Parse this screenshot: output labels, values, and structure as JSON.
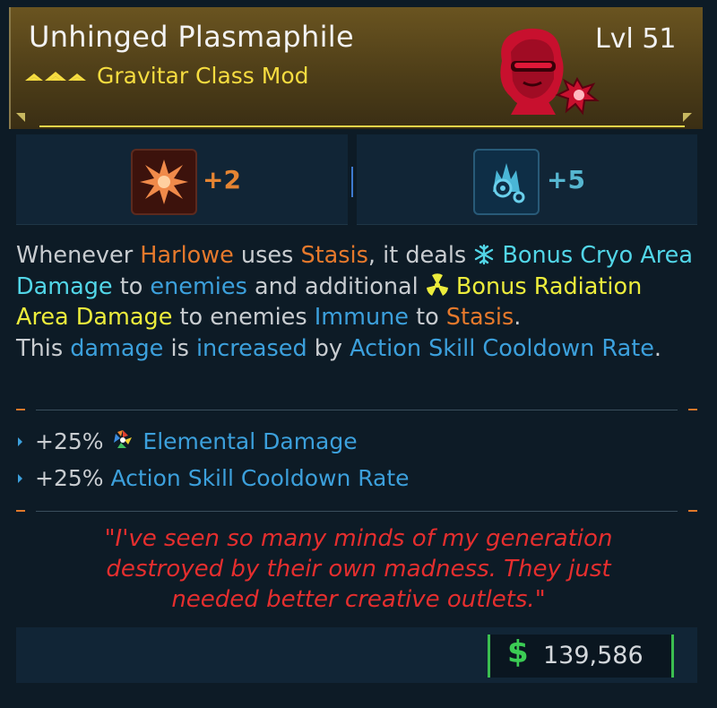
{
  "item": {
    "name": "Unhinged Plasmaphile",
    "type": "Gravitar Class Mod",
    "level": "Lvl 51"
  },
  "skills": {
    "left_bonus": "+2",
    "right_bonus": "+5"
  },
  "description": {
    "p1": "Whenever ",
    "harlowe": "Harlowe",
    "p2": " uses ",
    "stasis1": "Stasis",
    "p3": ", it deals ",
    "bonus_cryo": "Bonus Cryo Area Damage",
    "p4": " to ",
    "enemies1": "enemies",
    "p5": " and additional ",
    "bonus_rad": "Bonus Radiation Area Damage",
    "p6": " to enemies ",
    "immune": "Immune",
    "p7": " to ",
    "stasis2": "Stasis",
    "p8": ".",
    "p9": "This ",
    "damage": "damage",
    "p10": " is ",
    "increased": "increased",
    "p11": " by ",
    "cooldown": "Action Skill Cooldown Rate",
    "p12": "."
  },
  "stats": [
    {
      "value": "+25%",
      "label": "Elemental Damage"
    },
    {
      "value": "+25%",
      "label": "Action Skill Cooldown Rate"
    }
  ],
  "quote": {
    "line1": "\"I've seen so many minds of my generation",
    "line2": "destroyed by their own madness. They just",
    "line3": "needed better creative outlets.\""
  },
  "price": {
    "currency": "$",
    "amount": "139,586"
  },
  "colors": {
    "rarity_gold": "#f6dc40",
    "keyword_orange": "#e6792c",
    "keyword_cyan": "#52d6e8",
    "keyword_blue": "#3ca0dc",
    "keyword_yellow": "#ecec3c",
    "quote_red": "#e52e2e",
    "money_green": "#3bcc54"
  },
  "icons": {
    "rarity": "rarity-chevrons-icon",
    "portrait": "harlowe-portrait-icon",
    "skill_left": "starburst-skill-icon",
    "skill_right": "cryo-gear-skill-icon",
    "cryo": "snowflake-icon",
    "radiation": "radiation-icon",
    "elemental": "elemental-wheel-icon"
  }
}
